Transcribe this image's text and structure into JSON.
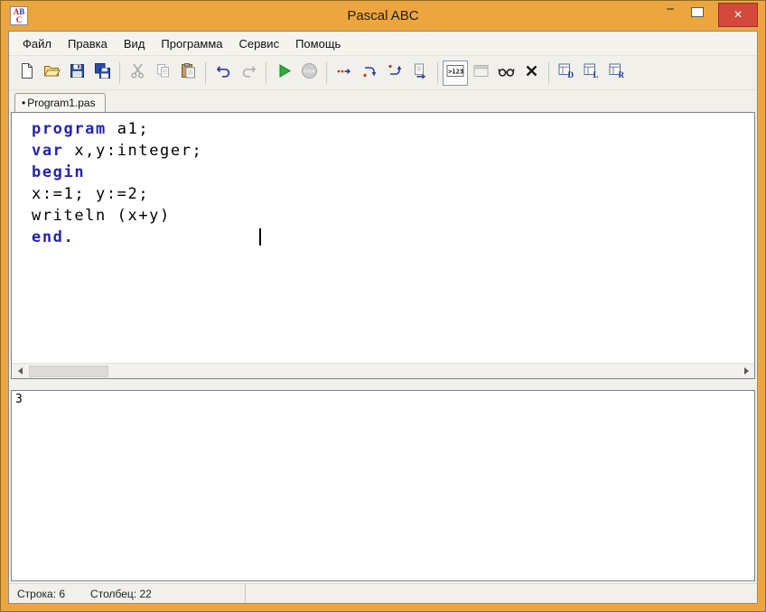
{
  "window": {
    "title": "Pascal ABC",
    "icon_letters": [
      "A",
      "B",
      "C"
    ],
    "controls": {
      "minimize": "−",
      "close": "×"
    }
  },
  "menu": {
    "items": [
      {
        "id": "file",
        "label": "Файл"
      },
      {
        "id": "edit",
        "label": "Правка"
      },
      {
        "id": "view",
        "label": "Вид"
      },
      {
        "id": "program",
        "label": "Программа"
      },
      {
        "id": "service",
        "label": "Сервис"
      },
      {
        "id": "help",
        "label": "Помощь"
      }
    ]
  },
  "toolbar": {
    "items": [
      {
        "name": "new-file",
        "icon": "new-file-icon"
      },
      {
        "name": "open-file",
        "icon": "open-folder-icon"
      },
      {
        "name": "save-file",
        "icon": "save-icon"
      },
      {
        "name": "save-all",
        "icon": "save-all-icon"
      },
      {
        "separator": true
      },
      {
        "name": "cut",
        "icon": "cut-icon",
        "disabled": true
      },
      {
        "name": "copy",
        "icon": "copy-icon",
        "disabled": true
      },
      {
        "name": "paste",
        "icon": "paste-icon"
      },
      {
        "separator": true
      },
      {
        "name": "undo",
        "icon": "undo-icon"
      },
      {
        "name": "redo",
        "icon": "redo-icon",
        "disabled": true
      },
      {
        "separator": true
      },
      {
        "name": "run",
        "icon": "run-icon"
      },
      {
        "name": "stop",
        "icon": "stop-icon",
        "disabled": true
      },
      {
        "separator": true
      },
      {
        "name": "step-into",
        "icon": "step-into-icon"
      },
      {
        "name": "step-over",
        "icon": "step-over-icon"
      },
      {
        "name": "step-out",
        "icon": "step-out-icon"
      },
      {
        "name": "run-to-cursor",
        "icon": "run-to-cursor-icon"
      },
      {
        "separator": true
      },
      {
        "name": "show-output-window",
        "icon": "output-window-icon",
        "pressed": true
      },
      {
        "name": "show-form-window",
        "icon": "form-window-icon",
        "disabled": true
      },
      {
        "name": "watch-window",
        "icon": "watch-glasses-icon"
      },
      {
        "name": "clear-watch",
        "icon": "clear-x-icon"
      },
      {
        "separator": true
      },
      {
        "name": "module-d",
        "icon": "module-d-icon"
      },
      {
        "name": "module-l",
        "icon": "module-l-icon"
      },
      {
        "name": "module-r",
        "icon": "module-r-icon"
      }
    ]
  },
  "tabbar": {
    "tabs": [
      {
        "label": "Program1.pas",
        "modified_marker": "•",
        "active": true
      }
    ]
  },
  "editor": {
    "keyword_color": "#2222BB",
    "lines": [
      {
        "segments": [
          {
            "text": "program",
            "keyword": true
          },
          {
            "text": " a1;",
            "keyword": false
          }
        ]
      },
      {
        "segments": [
          {
            "text": "var",
            "keyword": true
          },
          {
            "text": " x,y:integer;",
            "keyword": false
          }
        ]
      },
      {
        "segments": [
          {
            "text": "begin",
            "keyword": true
          }
        ]
      },
      {
        "segments": [
          {
            "text": "x:=1; y:=2;",
            "keyword": false
          }
        ]
      },
      {
        "segments": [
          {
            "text": "writeln (x+y)",
            "keyword": false
          }
        ]
      },
      {
        "segments": [
          {
            "text": "end.",
            "keyword": true
          }
        ]
      }
    ],
    "cursor": {
      "line": 6,
      "column": 22
    }
  },
  "output": {
    "text": "3"
  },
  "statusbar": {
    "line_label": "Строка: 6",
    "column_label": "Столбец: 22"
  }
}
